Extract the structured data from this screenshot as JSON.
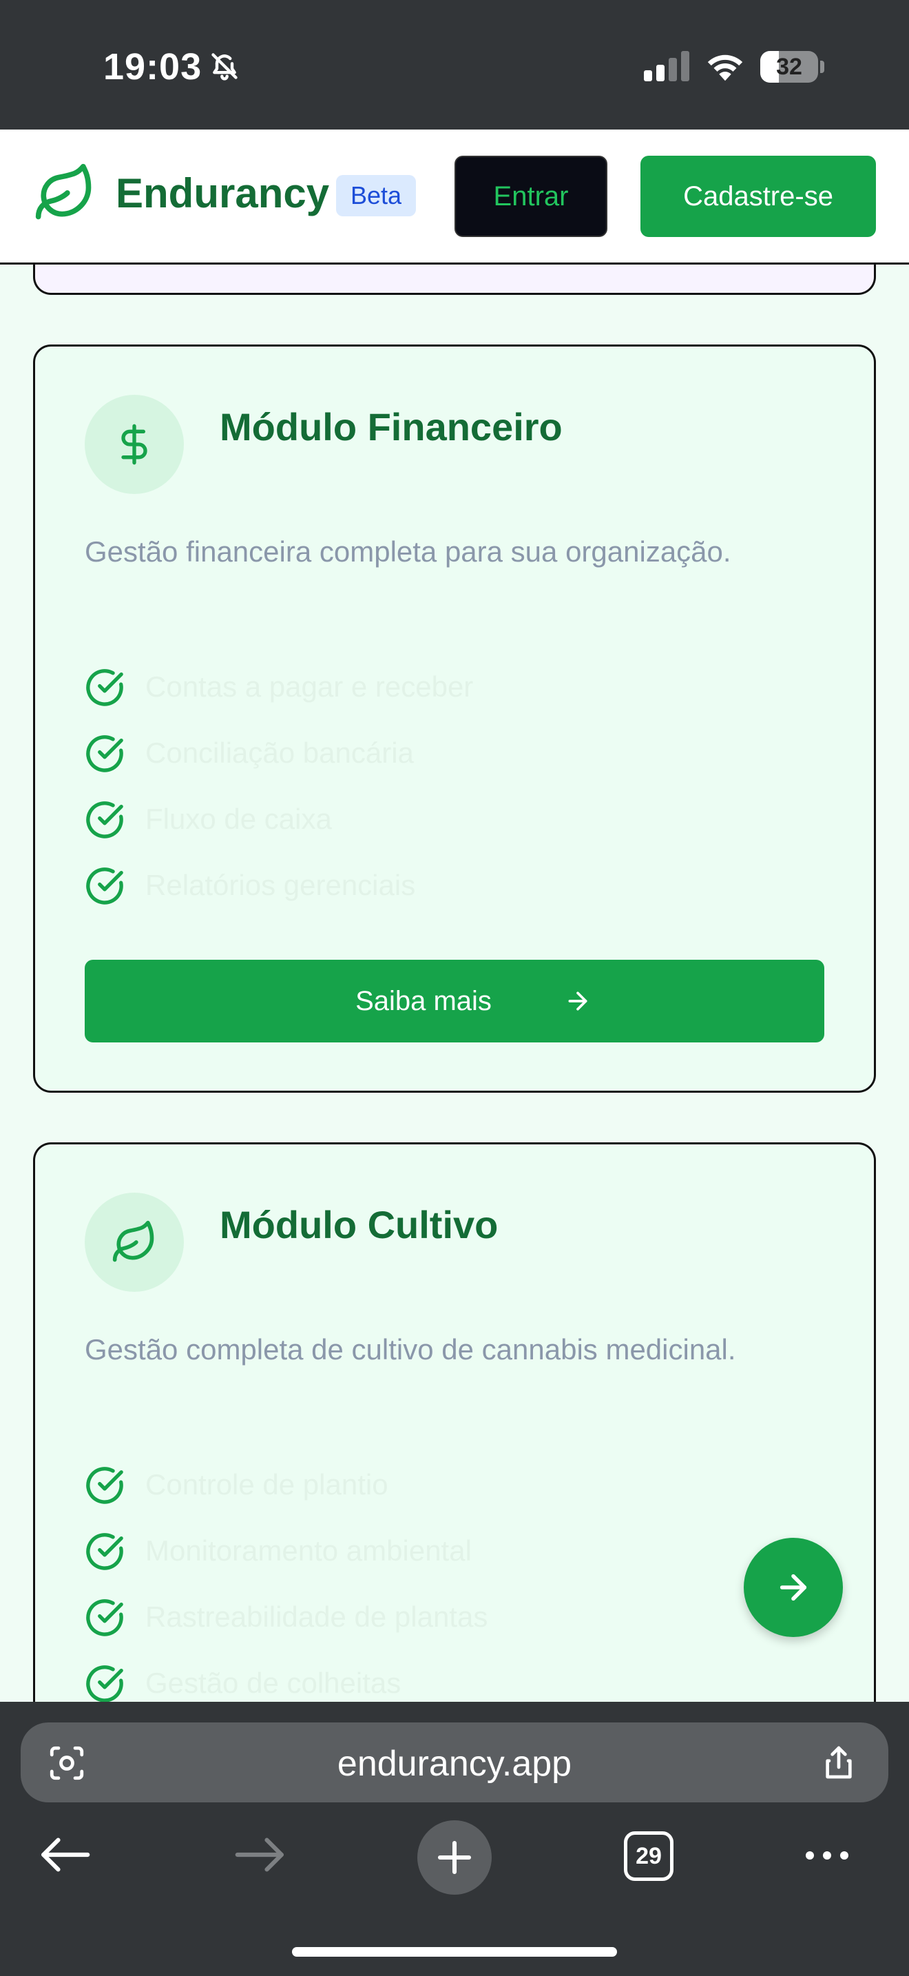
{
  "status_bar": {
    "time": "19:03",
    "battery": "32",
    "battery_level": 0.32,
    "icons": [
      "bell-slash-icon",
      "signal-icon",
      "wifi-icon",
      "battery-icon"
    ]
  },
  "header": {
    "brand": "Endurancy",
    "badge": "Beta",
    "login_label": "Entrar",
    "signup_label": "Cadastre-se",
    "logo_icon": "leaf-icon"
  },
  "modules": [
    {
      "title": "Módulo Financeiro",
      "icon": "dollar-icon",
      "description": "Gestão financeira completa para sua organização.",
      "features": [
        "Contas a pagar e receber",
        "Conciliação bancária",
        "Fluxo de caixa",
        "Relatórios gerenciais"
      ],
      "cta": "Saiba mais"
    },
    {
      "title": "Módulo Cultivo",
      "icon": "leaf-icon",
      "description": "Gestão completa de cultivo de cannabis medicinal.",
      "features": [
        "Controle de plantio",
        "Monitoramento ambiental",
        "Rastreabilidade de plantas",
        "Gestão de colheitas"
      ]
    }
  ],
  "browser": {
    "url": "endurancy.app",
    "tab_count": "29"
  },
  "colors": {
    "accent": "#16a34a",
    "brand_text": "#146c36",
    "card_bg": "#ecfdf3",
    "status_bar": "#323538"
  }
}
